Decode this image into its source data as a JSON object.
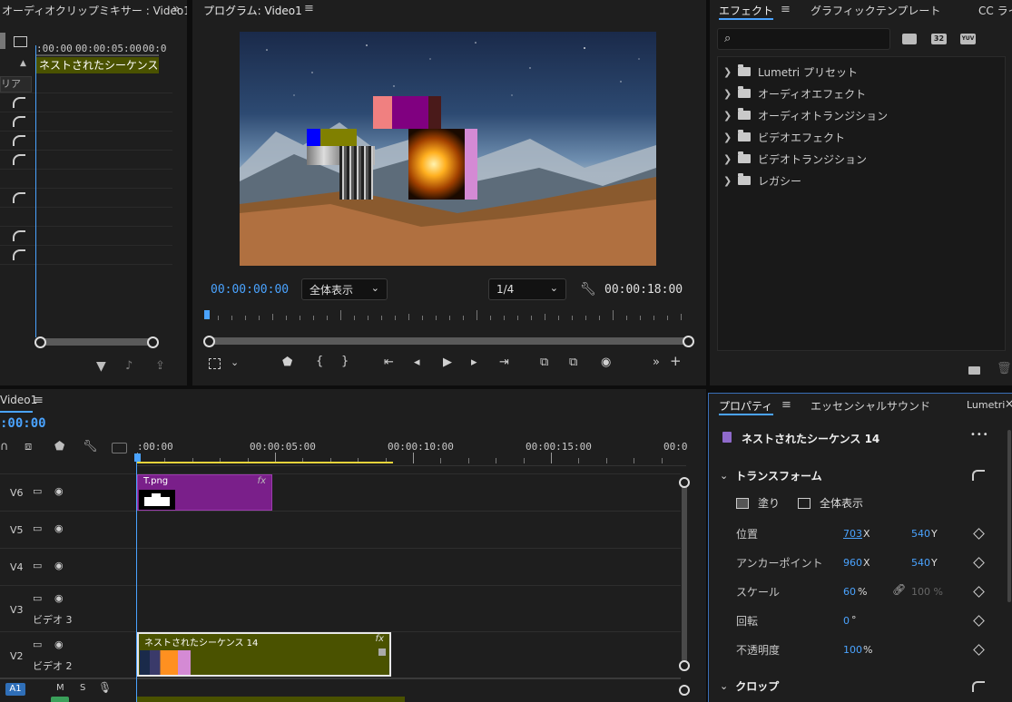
{
  "mixer": {
    "title": "オーディオクリップミキサー : Video1",
    "expand": "»",
    "tc_start": ":00:00",
    "tc_mid": "00:00:05:00",
    "tc_end": "00:0",
    "clip": "ネストされたシーケンス",
    "label": "リア"
  },
  "program": {
    "title": "プログラム: Video1",
    "timecode_current": "00:00:00:00",
    "timecode_duration": "00:00:18:00",
    "fit": "全体表示",
    "resolution": "1/4"
  },
  "effects": {
    "tab_effects": "エフェクト",
    "tab_graphics": "グラフィックテンプレート",
    "tab_cc": "CC ライ",
    "search_placeholder": "",
    "badge_32": "32",
    "badge_yuv": "YUV",
    "items": [
      "Lumetri プリセット",
      "オーディオエフェクト",
      "オーディオトランジション",
      "ビデオエフェクト",
      "ビデオトランジション",
      "レガシー"
    ]
  },
  "timeline": {
    "title": "Video1",
    "timecode": ":00:00",
    "ruler": [
      ":00:00",
      "00:00:05:00",
      "00:00:10:00",
      "00:00:15:00",
      "00:0"
    ],
    "tracks": [
      "V6",
      "V5",
      "V4",
      "V3",
      "V2"
    ],
    "v3_name": "ビデオ 3",
    "v2_name": "ビデオ 2",
    "audio_track": "A1",
    "audio_m": "M",
    "audio_s": "S",
    "clip_t": "T.png",
    "clip_nested": "ネストされたシーケンス 14",
    "fx": "fx"
  },
  "properties": {
    "tab_props": "プロパティ",
    "tab_essential": "エッセンシャルサウンド",
    "tab_lumetri": "Lumetri",
    "close": "×",
    "clip_name": "ネストされたシーケンス 14",
    "more": "•••",
    "section_transform": "トランスフォーム",
    "fill_label": "塗り",
    "fit_label": "全体表示",
    "position_label": "位置",
    "pos_x": "703",
    "pos_y": "540",
    "anchor_label": "アンカーポイント",
    "anchor_x": "960",
    "anchor_y": "540",
    "scale_label": "スケール",
    "scale": "60",
    "scale_linked": "100 %",
    "rotation_label": "回転",
    "rotation": "0",
    "deg": "°",
    "opacity_label": "不透明度",
    "opacity": "100",
    "pct": "%",
    "x": "X",
    "y": "Y",
    "section_crop": "クロップ"
  },
  "colors": {
    "accent": "#4aa3ff",
    "clip_purple": "#7a1f8a",
    "clip_olive": "#4a5200"
  }
}
